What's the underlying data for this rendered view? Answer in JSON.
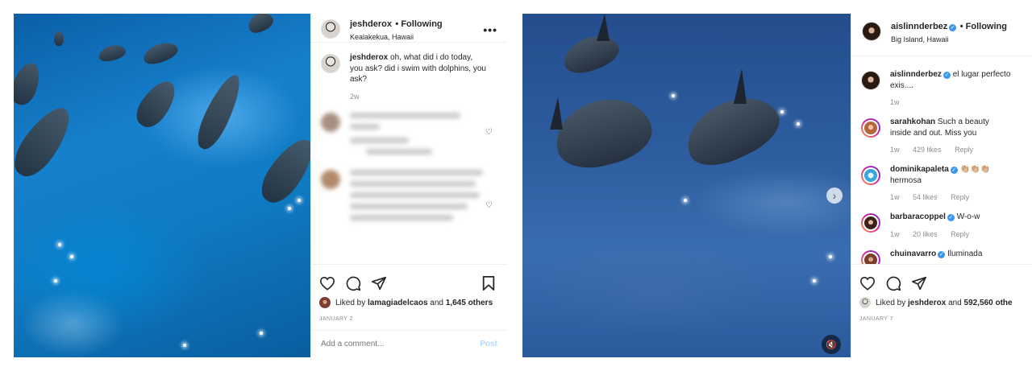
{
  "left_post": {
    "header": {
      "username": "jeshderox",
      "following": "• Following",
      "location": "Kealakekua, Hawaii",
      "more_icon": "more-options-icon"
    },
    "caption": {
      "username": "jeshderox",
      "text": "oh, what did i do today, you ask? did i swim with dolphins, you ask?",
      "time": "2w"
    },
    "likes": {
      "prefix": "Liked by",
      "user": "lamagiadelcaos",
      "and": "and",
      "count": "1,645 others"
    },
    "date": "JANUARY 2",
    "add_comment": {
      "placeholder": "Add a comment...",
      "post_label": "Post"
    }
  },
  "right_post": {
    "header": {
      "username": "aislinnderbez",
      "following": "• Following",
      "location": "Big Island, Hawaii"
    },
    "caption": {
      "username": "aislinnderbez",
      "text": "el lugar perfecto exis....",
      "time": "1w"
    },
    "comments": [
      {
        "username": "sarahkohan",
        "text": "Such a beauty inside and out. Miss you",
        "time": "1w",
        "likes": "429 likes",
        "reply": "Reply"
      },
      {
        "username": "dominikapaleta",
        "verified": true,
        "emoji": "👏🏼👏🏼👏🏼",
        "text": "hermosa",
        "time": "1w",
        "likes": "54 likes",
        "reply": "Reply"
      },
      {
        "username": "barbaracoppel",
        "verified": true,
        "text": "W-o-w",
        "time": "1w",
        "likes": "20 likes",
        "reply": "Reply"
      },
      {
        "username": "chuinavarro",
        "verified": true,
        "text": "Iluminada"
      }
    ],
    "likes": {
      "prefix": "Liked by",
      "user": "jeshderox",
      "and": "and",
      "count": "592,560 othe"
    },
    "date": "JANUARY 7"
  },
  "icons": [
    "heart-icon",
    "comment-icon",
    "share-icon",
    "bookmark-icon",
    "next-arrow-icon",
    "mute-icon",
    "verified-icon"
  ],
  "colors": {
    "accent": "#3897f0",
    "muted": "#8e8e8e",
    "post_button": "#b3dbff"
  }
}
